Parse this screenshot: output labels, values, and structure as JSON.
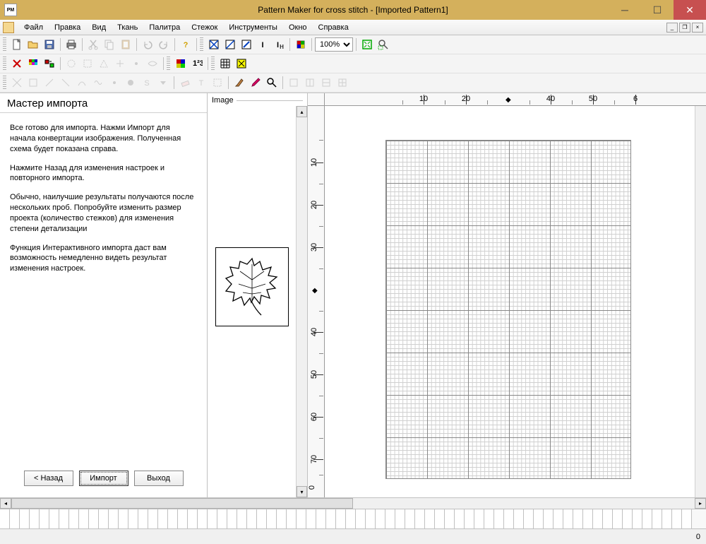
{
  "titlebar": {
    "app_icon_text": "PM",
    "title": "Pattern Maker for cross stitch - [Imported Pattern1]"
  },
  "menubar": {
    "items": [
      "Файл",
      "Правка",
      "Вид",
      "Ткань",
      "Палитра",
      "Стежок",
      "Инструменты",
      "Окно",
      "Справка"
    ]
  },
  "toolbar": {
    "zoom_value": "100%"
  },
  "wizard": {
    "title": "Мастер импорта",
    "p1": "Все готово для импорта.  Нажми Импорт для начала конвертации изображения.  Полученная схема будет показана справа.",
    "p2": "Нажмите Назад для изменения настроек и повторного импорта.",
    "p3": "Обычно, наилучшие результаты получаются после нескольких проб.  Попробуйте изменить размер проекта (количество стежков) для изменения степени детализации",
    "p4": "Функция Интерактивного импорта даст вам возможность немедленно видеть результат изменения настроек.",
    "btn_back": "< Назад",
    "btn_import": "Импорт",
    "btn_exit": "Выход"
  },
  "image_pane": {
    "label": "Image"
  },
  "ruler": {
    "h_ticks": [
      "10",
      "20",
      "40",
      "50",
      "6"
    ],
    "v_ticks": [
      "10",
      "20",
      "30",
      "40",
      "50",
      "60",
      "70",
      "0"
    ]
  },
  "status": {
    "coord": "0"
  }
}
